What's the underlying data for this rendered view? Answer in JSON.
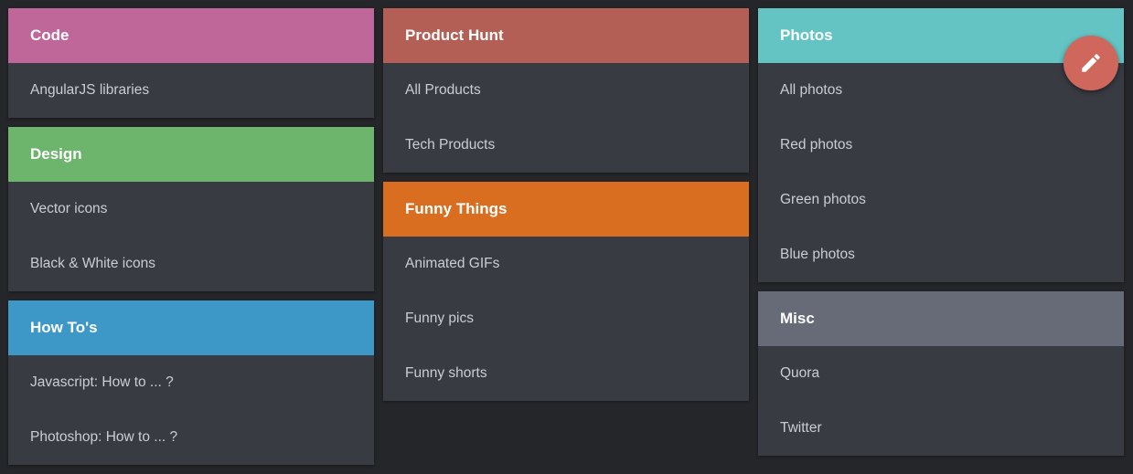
{
  "columns": [
    [
      {
        "title": "Code",
        "color": "#c0679a",
        "items": [
          "AngularJS libraries"
        ]
      },
      {
        "title": "Design",
        "color": "#6db56d",
        "items": [
          "Vector icons",
          "Black & White icons"
        ]
      },
      {
        "title": "How To's",
        "color": "#3e98c7",
        "items": [
          "Javascript: How to ... ?",
          "Photoshop: How to ... ?"
        ]
      }
    ],
    [
      {
        "title": "Product Hunt",
        "color": "#b35f55",
        "items": [
          "All Products",
          "Tech Products"
        ]
      },
      {
        "title": "Funny Things",
        "color": "#d96e20",
        "items": [
          "Animated GIFs",
          "Funny pics",
          "Funny shorts"
        ]
      }
    ],
    [
      {
        "title": "Photos",
        "color": "#64c4c3",
        "items": [
          "All photos",
          "Red photos",
          "Green photos",
          "Blue photos"
        ]
      },
      {
        "title": "Misc",
        "color": "#666b77",
        "items": [
          "Quora",
          "Twitter"
        ]
      }
    ]
  ],
  "fab": {
    "icon": "pencil-icon",
    "color": "#d0675d"
  }
}
